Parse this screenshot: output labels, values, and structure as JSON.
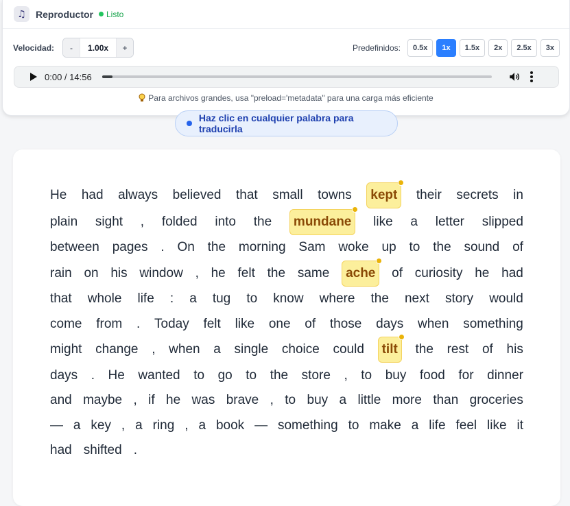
{
  "app": {
    "title": "Reproductor",
    "status": "Listo",
    "icon": "music-note-icon"
  },
  "speed": {
    "label": "Velocidad:",
    "decrement": "-",
    "value": "1.00x",
    "increment": "+",
    "presets_label": "Predefinidos:",
    "presets": [
      "0.5x",
      "1x",
      "1.5x",
      "2x",
      "2.5x",
      "3x"
    ],
    "active_preset": "1x"
  },
  "audio": {
    "time": "0:00 / 14:56",
    "progress": 0.0
  },
  "tip": "Para archivos grandes, usa \"preload='metadata\" para una carga más eficiente",
  "hint": "Haz clic en cualquier palabra para traducirla",
  "colors": {
    "accent": "#2b7fff",
    "highlight": "#fcef9c",
    "highlight_text": "#8a4a06",
    "status": "#22c55e"
  },
  "text": {
    "lines": [
      [
        "He",
        "had",
        "always",
        "believed",
        "that",
        "small",
        "towns",
        "kept",
        "their",
        "secrets",
        "in"
      ],
      [
        "plain",
        "sight",
        ",",
        "folded",
        "into",
        "the",
        "mundane",
        "like",
        "a",
        "letter",
        "slipped"
      ],
      [
        "between",
        "pages",
        ".",
        "On",
        "the",
        "morning",
        "Sam",
        "woke",
        "up",
        "to",
        "the",
        "sound",
        "of"
      ],
      [
        "rain",
        "on",
        "his",
        "window",
        ",",
        "he",
        "felt",
        "the",
        "same",
        "ache",
        "of",
        "curiosity",
        "he",
        "had"
      ],
      [
        "that",
        "whole",
        "life",
        ":",
        "a",
        "tug",
        "to",
        "know",
        "where",
        "the",
        "next",
        "story",
        "would"
      ],
      [
        "come",
        "from",
        ".",
        "Today",
        "felt",
        "like",
        "one",
        "of",
        "those",
        "days",
        "when",
        "something"
      ],
      [
        "might",
        "change",
        ",",
        "when",
        "a",
        "single",
        "choice",
        "could",
        "tilt",
        "the",
        "rest",
        "of",
        "his"
      ],
      [
        "days",
        ".",
        "He",
        "wanted",
        "to",
        "go",
        "to",
        "the",
        "store",
        ",",
        "to",
        "buy",
        "food",
        "for",
        "dinner"
      ],
      [
        "and",
        "maybe",
        ",",
        "if",
        "he",
        "was",
        "brave",
        ",",
        "to",
        "buy",
        "a",
        "little",
        "more",
        "than",
        "groceries"
      ],
      [
        "—",
        "a",
        "key",
        ",",
        "a",
        "ring",
        ",",
        "a",
        "book",
        "—",
        "something",
        "to",
        "make",
        "a",
        "life",
        "feel",
        "like",
        "it"
      ],
      [
        "had",
        "shifted",
        "."
      ]
    ],
    "highlighted": [
      "kept",
      "mundane",
      "ache",
      "tilt"
    ]
  }
}
